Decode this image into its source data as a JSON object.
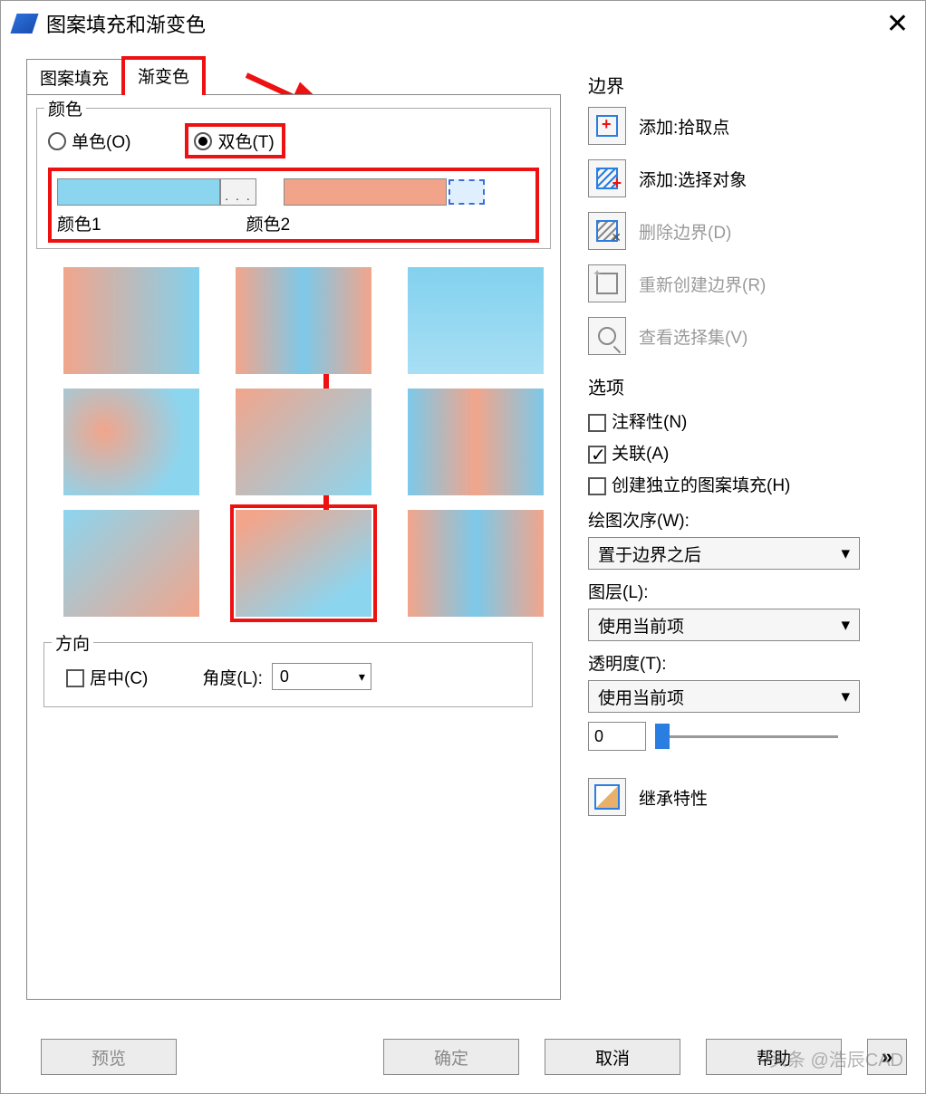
{
  "window": {
    "title": "图案填充和渐变色"
  },
  "tabs": {
    "hatch": "图案填充",
    "gradient": "渐变色"
  },
  "color_group": {
    "title": "颜色",
    "one_color": "单色(O)",
    "two_color": "双色(T)",
    "color1_label": "颜色1",
    "color2_label": "颜色2",
    "ellipsis": ". . ."
  },
  "direction_group": {
    "title": "方向",
    "center": "居中(C)",
    "angle_label": "角度(L):",
    "angle_value": "0"
  },
  "boundary": {
    "title": "边界",
    "add_pick": "添加:拾取点",
    "add_select": "添加:选择对象",
    "delete": "删除边界(D)",
    "recreate": "重新创建边界(R)",
    "view_sel": "查看选择集(V)"
  },
  "options": {
    "title": "选项",
    "annotative": "注释性(N)",
    "associative": "关联(A)",
    "separate": "创建独立的图案填充(H)",
    "draw_order_label": "绘图次序(W):",
    "draw_order_value": "置于边界之后",
    "layer_label": "图层(L):",
    "layer_value": "使用当前项",
    "transparency_label": "透明度(T):",
    "transparency_value": "使用当前项",
    "transparency_num": "0",
    "inherit": "继承特性"
  },
  "footer": {
    "preview": "预览",
    "ok": "确定",
    "cancel": "取消",
    "help": "帮助",
    "expand": "»"
  },
  "watermark": "头条 @浩辰CAD"
}
